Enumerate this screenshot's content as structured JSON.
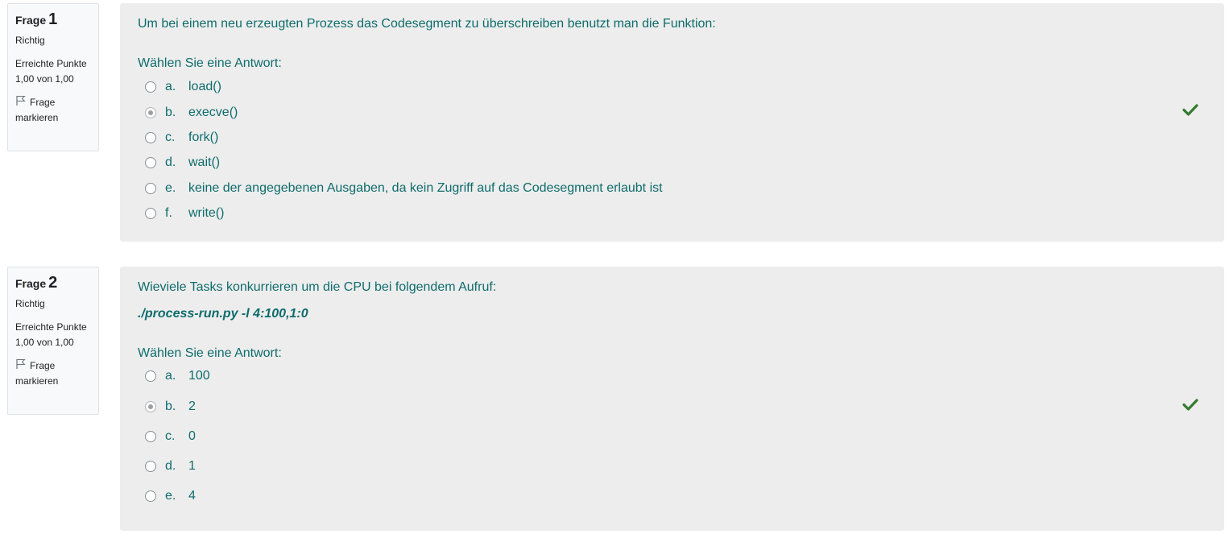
{
  "questions": [
    {
      "label": "Frage",
      "number": "1",
      "state": "Richtig",
      "grade": "Erreichte Punkte 1,00 von 1,00",
      "flag_label": "Frage markieren",
      "text": "Um bei einem neu erzeugten Prozess das Codesegment zu überschreiben benutzt man die Funktion:",
      "code": "",
      "prompt": "Wählen Sie eine Antwort:",
      "answers": [
        {
          "letter": "a.",
          "text": "load()",
          "selected": false
        },
        {
          "letter": "b.",
          "text": "execve()",
          "selected": true
        },
        {
          "letter": "c.",
          "text": "fork()",
          "selected": false
        },
        {
          "letter": "d.",
          "text": "wait()",
          "selected": false
        },
        {
          "letter": "e.",
          "text": "keine der angegebenen Ausgaben, da kein Zugriff auf das Codesegment erlaubt ist",
          "selected": false
        },
        {
          "letter": "f.",
          "text": "write()",
          "selected": false
        }
      ],
      "feedback_icon": "check-icon",
      "feedback_color": "#357a32"
    },
    {
      "label": "Frage",
      "number": "2",
      "state": "Richtig",
      "grade": "Erreichte Punkte 1,00 von 1,00",
      "flag_label": "Frage markieren",
      "text": "Wieviele Tasks konkurrieren um die CPU bei folgendem Aufruf:",
      "code": "./process-run.py -l 4:100,1:0",
      "prompt": "Wählen Sie eine Antwort:",
      "answers": [
        {
          "letter": "a.",
          "text": "100",
          "selected": false
        },
        {
          "letter": "b.",
          "text": "2",
          "selected": true
        },
        {
          "letter": "c.",
          "text": "0",
          "selected": false
        },
        {
          "letter": "d.",
          "text": "1",
          "selected": false
        },
        {
          "letter": "e.",
          "text": "4",
          "selected": false
        }
      ],
      "feedback_icon": "check-icon",
      "feedback_color": "#357a32"
    }
  ]
}
